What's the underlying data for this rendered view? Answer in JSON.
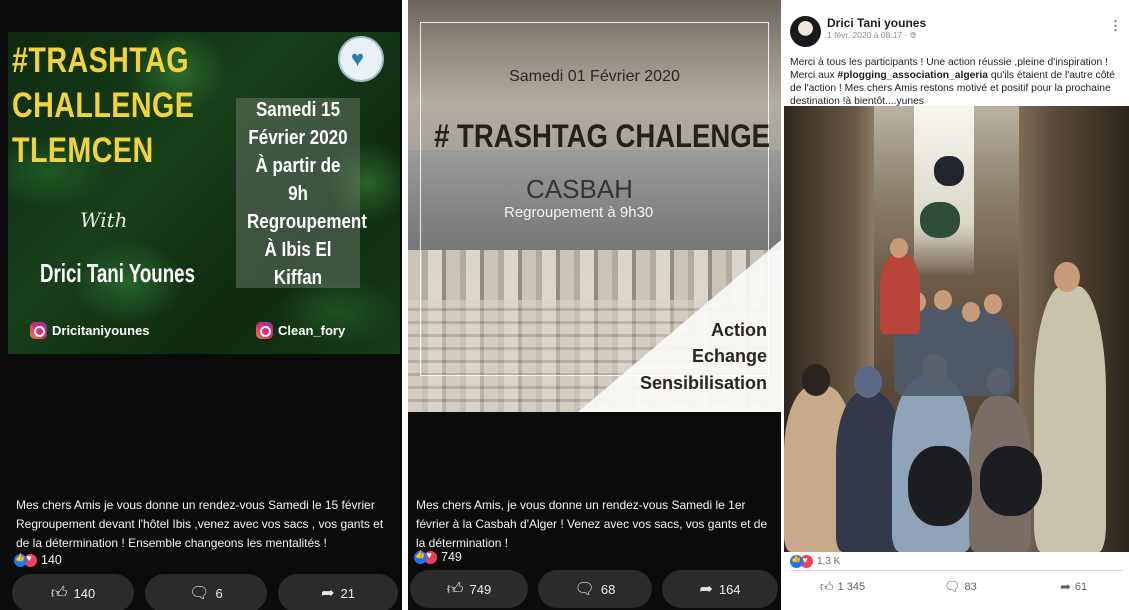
{
  "post1": {
    "poster": {
      "title_lines": [
        "#TRASHTAG",
        "CHALLENGE",
        "TLEMCEN"
      ],
      "with": "With",
      "name": "Drici Tani Younes",
      "box_lines": [
        "Samedi 15",
        "Février 2020",
        "À partir de 9h",
        "Regroupement",
        "À Ibis El",
        "Kiffan"
      ],
      "instagram_left": "Dricitaniyounes",
      "instagram_right": "Clean_fory"
    },
    "caption": "Mes chers Amis je vous donne un rendez-vous Samedi le 15 février Regroupement devant l'hôtel Ibis ,venez avec vos sacs , vos gants et de la détermination ! Ensemble changeons les mentalités !",
    "reaction_count": "140",
    "actions": {
      "likes": "140",
      "comments": "6",
      "shares": "21"
    }
  },
  "post2": {
    "poster": {
      "date": "Samedi 01 Février 2020",
      "title": "# TRASHTAG CHALENGE",
      "place": "CASBAH",
      "regroup": "Regroupement  à 9h30",
      "tags": [
        "Action",
        "Echange",
        "Sensibilisation"
      ]
    },
    "caption": "Mes chers Amis, je vous donne un rendez-vous Samedi le 1er février à la Casbah d'Alger ! Venez avec vos sacs, vos gants et de la détermination !",
    "reaction_count": "749",
    "actions": {
      "likes": "749",
      "comments": "68",
      "shares": "164"
    }
  },
  "post3": {
    "author": "Drici Tani younes",
    "meta": "1 févr. 2020 à 08:17 · ",
    "more": "⋮",
    "text_before": "Merci à tous les participants ! Une action réussie ,pleine d'inspiration ! Merci aux ",
    "hashtag": "#plogging_association_algeria",
    "text_after": " qu'ils étaient de l'autre côté de l'action ! Mes chers Amis restons motivé et positif pour la prochaine destination !à bientôt....yunes",
    "reaction_count": "1,3 K",
    "actions": {
      "likes": "1 345",
      "comments": "83",
      "shares": "61"
    }
  },
  "colors": {
    "poster_title_yellow": "#f2d33b",
    "like_blue": "#1877f2",
    "love_red": "#f33e58",
    "dark_bg": "#0b0b0b",
    "pill_bg": "#2b2b2b"
  },
  "icons": [
    "thumbs-up-icon",
    "comment-icon",
    "share-icon",
    "instagram-icon",
    "globe-icon",
    "more-options-icon"
  ]
}
